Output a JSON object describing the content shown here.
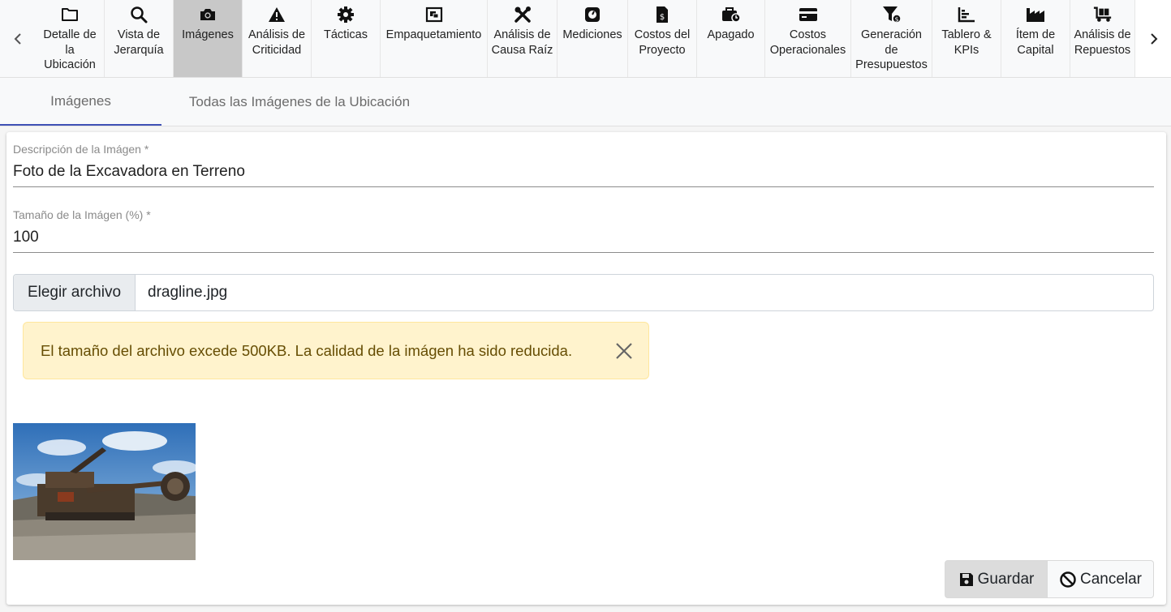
{
  "toolbar": {
    "items": [
      {
        "label": "Detalle de la Ubicación",
        "icon": "folder-icon"
      },
      {
        "label": "Vista de Jerarquía",
        "icon": "search-icon"
      },
      {
        "label": "Imágenes",
        "icon": "camera-icon"
      },
      {
        "label": "Análisis de Criticidad",
        "icon": "warning-icon"
      },
      {
        "label": "Tácticas",
        "icon": "gear-icon"
      },
      {
        "label": "Empaquetamiento",
        "icon": "package-icon"
      },
      {
        "label": "Análisis de Causa Raíz",
        "icon": "tools-icon"
      },
      {
        "label": "Mediciones",
        "icon": "gauge-icon"
      },
      {
        "label": "Costos del Proyecto",
        "icon": "invoice-dollar-icon"
      },
      {
        "label": "Apagado",
        "icon": "briefcase-clock-icon"
      },
      {
        "label": "Costos Operacionales",
        "icon": "credit-card-icon"
      },
      {
        "label": "Generación de Presupuestos",
        "icon": "funnel-dollar-icon"
      },
      {
        "label": "Tablero & KPIs",
        "icon": "bar-chart-icon"
      },
      {
        "label": "Ítem de Capital",
        "icon": "factory-icon"
      },
      {
        "label": "Análisis de Repuestos",
        "icon": "dolly-icon"
      }
    ],
    "active": "Imágenes"
  },
  "tabs": [
    {
      "label": "Imágenes"
    },
    {
      "label": "Todas las Imágenes de la Ubicación"
    }
  ],
  "form": {
    "description": {
      "label": "Descripción de la Imágen *",
      "value": "Foto de la Excavadora en Terreno"
    },
    "size": {
      "label": "Tamaño de la Imágen (%) *",
      "value": "100"
    },
    "file": {
      "button_label": "Elegir archivo",
      "file_name": "dragline.jpg"
    },
    "alert": {
      "text": "El tamaño del archivo excede 500KB. La calidad de la imágen ha sido reducida."
    }
  },
  "actions": {
    "save_label": "Guardar",
    "cancel_label": "Cancelar"
  },
  "colors": {
    "tab_indicator": "#3f51b5",
    "alert_bg": "#fff3cd",
    "alert_text": "#664d03"
  }
}
